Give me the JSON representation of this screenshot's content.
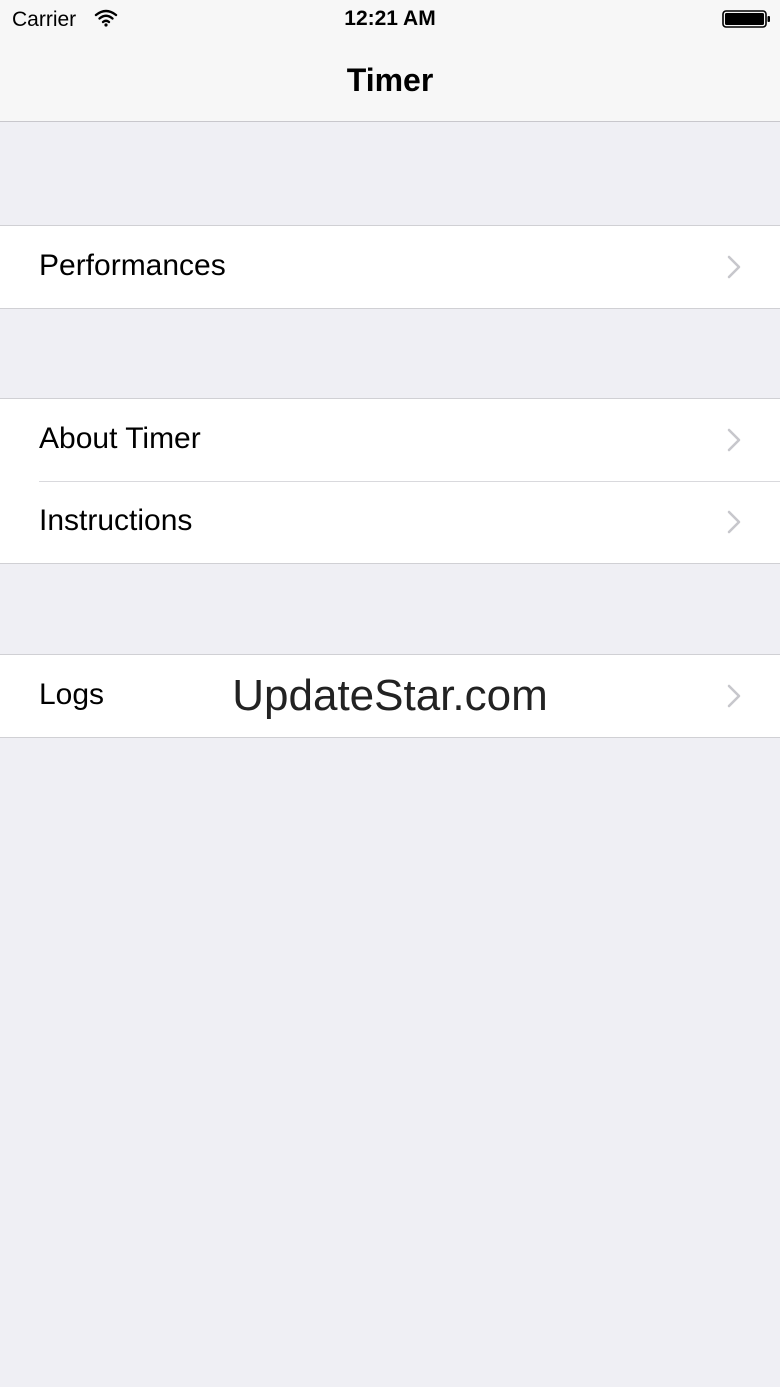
{
  "status_bar": {
    "carrier": "Carrier",
    "time": "12:21 AM",
    "wifi_icon": "wifi-icon",
    "battery_icon": "battery-icon"
  },
  "nav": {
    "title": "Timer"
  },
  "sections": [
    {
      "items": [
        {
          "label": "Performances",
          "icon": "chevron-right-icon"
        }
      ]
    },
    {
      "items": [
        {
          "label": "About Timer",
          "icon": "chevron-right-icon"
        },
        {
          "label": "Instructions",
          "icon": "chevron-right-icon"
        }
      ]
    },
    {
      "items": [
        {
          "label": "Logs",
          "icon": "chevron-right-icon"
        }
      ]
    }
  ],
  "watermark": "UpdateStar.com",
  "colors": {
    "background": "#efeff4",
    "cell": "#ffffff",
    "chevron": "#c7c7cc"
  }
}
